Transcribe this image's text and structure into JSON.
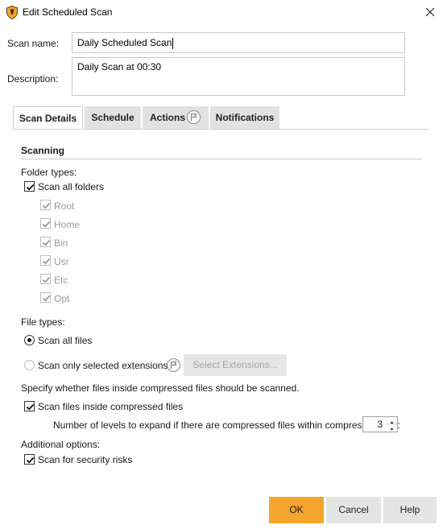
{
  "window": {
    "title": "Edit Scheduled Scan",
    "brand_color": "#f5a52e"
  },
  "form": {
    "scan_name_label": "Scan name:",
    "scan_name_value": "Daily Scheduled Scan",
    "description_label": "Description:",
    "description_value": "Daily Scan at 00:30"
  },
  "tabs": [
    {
      "label": "Scan Details",
      "active": true
    },
    {
      "label": "Schedule",
      "active": false
    },
    {
      "label": "Actions",
      "active": false,
      "icon": "flag-icon"
    },
    {
      "label": "Notifications",
      "active": false
    }
  ],
  "scanning": {
    "section_title": "Scanning",
    "folder_types_label": "Folder types:",
    "scan_all_folders": {
      "label": "Scan all folders",
      "checked": true
    },
    "folders": [
      {
        "label": "Root",
        "checked": true,
        "disabled": true
      },
      {
        "label": "Home",
        "checked": true,
        "disabled": true
      },
      {
        "label": "Bin",
        "checked": true,
        "disabled": true
      },
      {
        "label": "Usr",
        "checked": true,
        "disabled": true
      },
      {
        "label": "Etc",
        "checked": true,
        "disabled": true
      },
      {
        "label": "Opt",
        "checked": true,
        "disabled": true
      }
    ],
    "file_types_label": "File types:",
    "scan_all_files": {
      "label": "Scan all files",
      "selected": true
    },
    "scan_selected_ext": {
      "label": "Scan only selected extensions:",
      "selected": false
    },
    "select_extensions_button": "Select Extensions...",
    "compressed_note": "Specify whether files inside compressed files should be scanned.",
    "scan_compressed": {
      "label": "Scan files inside compressed files",
      "checked": true
    },
    "levels_label": "Number of levels to expand if there are compressed files within compressed files:",
    "levels_value": "3",
    "additional_label": "Additional options:",
    "security_risks": {
      "label": "Scan for security risks",
      "checked": true
    }
  },
  "buttons": {
    "ok": "OK",
    "cancel": "Cancel",
    "help": "Help"
  }
}
